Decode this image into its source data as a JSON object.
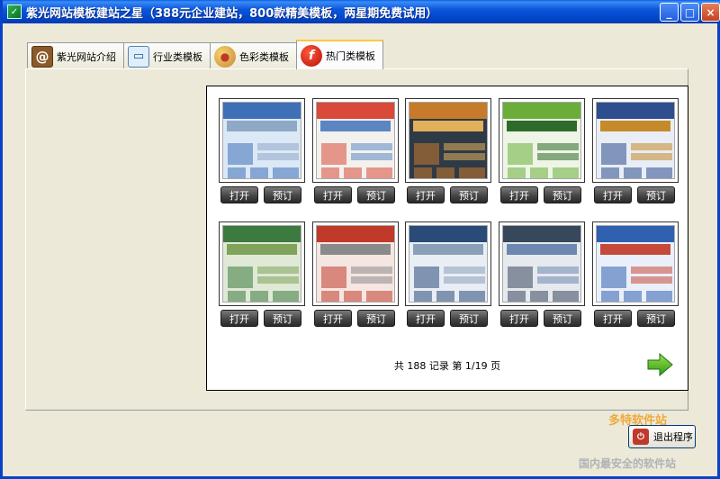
{
  "window": {
    "title": "紫光网站模板建站之星（388元企业建站，800款精美模板，两星期免费试用）",
    "minimize_glyph": "_",
    "maximize_glyph": "□",
    "close_glyph": "×"
  },
  "tabs": [
    {
      "label": "紫光网站介绍",
      "icon": "book-icon",
      "active": false
    },
    {
      "label": "行业类模板",
      "icon": "monitor-icon",
      "active": false
    },
    {
      "label": "色彩类模板",
      "icon": "palette-icon",
      "active": false
    },
    {
      "label": "热门类模板",
      "icon": "flash-icon",
      "active": true
    }
  ],
  "templates": {
    "open_label": "打开",
    "order_label": "预订",
    "rows": [
      [
        {
          "colors": [
            "#3f6fb7",
            "#dbe8f6",
            "#8fa8c6"
          ]
        },
        {
          "colors": [
            "#d94a3a",
            "#f3f1ee",
            "#5b86c2"
          ]
        },
        {
          "colors": [
            "#c77a2a",
            "#2f3a47",
            "#e2b05a"
          ]
        },
        {
          "colors": [
            "#6aae39",
            "#eef4e6",
            "#2d6b2a"
          ]
        },
        {
          "colors": [
            "#2e4e8e",
            "#e8edf6",
            "#c58b2a"
          ]
        }
      ],
      [
        {
          "colors": [
            "#3c7a3f",
            "#dfe9d6",
            "#7fa35b"
          ]
        },
        {
          "colors": [
            "#c03a2a",
            "#f5e6e2",
            "#8a8a8a"
          ]
        },
        {
          "colors": [
            "#2a4a78",
            "#e9eef5",
            "#8aa0b8"
          ]
        },
        {
          "colors": [
            "#37475c",
            "#e6e9ee",
            "#6d88b0"
          ]
        },
        {
          "colors": [
            "#3060b0",
            "#eaf0fa",
            "#c64a3a"
          ]
        }
      ]
    ]
  },
  "pager": {
    "text": "共 188 记录   第 1/19 页",
    "next_arrow": "next-arrow-icon"
  },
  "exit_button": {
    "label": "退出程序",
    "icon": "exit-icon"
  },
  "watermark": {
    "logo": "多特软件站",
    "footer": "国内最安全的软件站"
  }
}
